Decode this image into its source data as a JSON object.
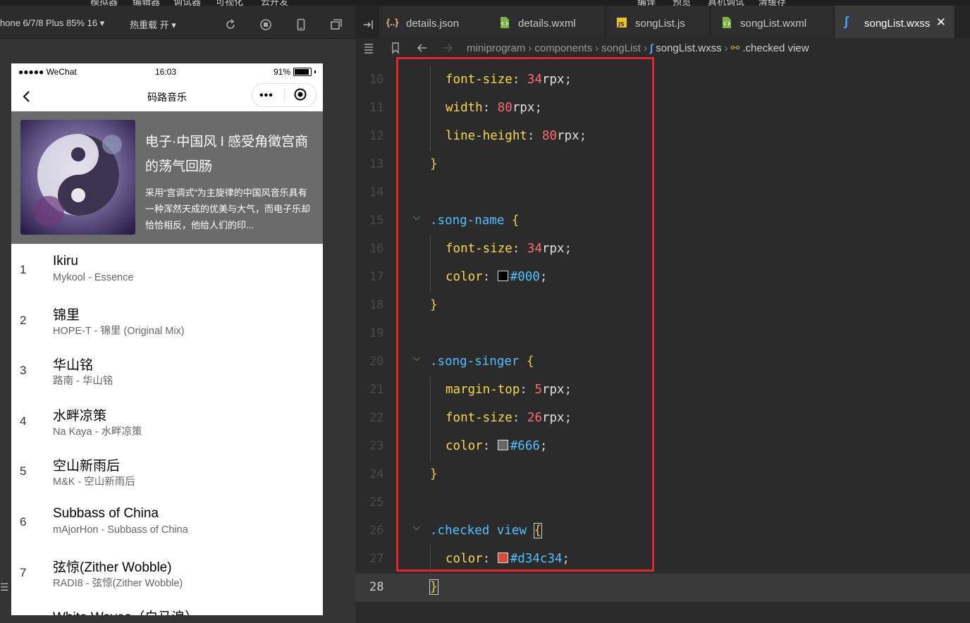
{
  "menu_strip": {
    "left_items": [
      "模拟器",
      "编辑器",
      "调试器",
      "可视化",
      "云开发"
    ],
    "right_items": [
      "编译",
      "预览",
      "真机调试",
      "清缓存"
    ]
  },
  "simulator_toolbar": {
    "device": "hone 6/7/8 Plus 85% 16 ▾",
    "hot_reload": "热重载 开 ▾",
    "icons": [
      "refresh-icon",
      "stop-icon",
      "phone-icon",
      "window-icon"
    ]
  },
  "phone": {
    "status": {
      "carrier": "●●●●● WeChat",
      "time": "16:03",
      "battery": "91%",
      "battery_level": 0.91
    },
    "nav": {
      "title": "码路音乐",
      "menu_dots": "•••"
    },
    "album": {
      "title": "电子·中国风 I 感受角徵宫商的荡气回肠",
      "description": "采用“宫调式”为主旋律的中国风音乐具有一种浑然天成的优美与大气，而电子乐却恰恰相反，他给人们的印..."
    },
    "songs": [
      {
        "index": "1",
        "name": "Ikiru",
        "singer": "Mykool - Essence"
      },
      {
        "index": "2",
        "name": "锦里",
        "singer": "HOPE-T - 锦里 (Original Mix)"
      },
      {
        "index": "3",
        "name": "华山铭",
        "singer": "路南 - 华山铭"
      },
      {
        "index": "4",
        "name": "水畔凉策",
        "singer": "Na Kaya - 水畔凉策"
      },
      {
        "index": "5",
        "name": "空山新雨后",
        "singer": "M&K - 空山新雨后"
      },
      {
        "index": "6",
        "name": "Subbass of China",
        "singer": "mAjorHon - Subbass of China"
      },
      {
        "index": "7",
        "name": "弦惊(Zither Wobble)",
        "singer": "RADI8 - 弦惊(Zither Wobble)"
      },
      {
        "index": "8",
        "name": "White Waves（白马浪）",
        "singer": ""
      }
    ]
  },
  "editor": {
    "tabs": [
      {
        "label": "details.json",
        "icon": "json-icon",
        "active": false
      },
      {
        "label": "details.wxml",
        "icon": "wxml-icon",
        "active": false
      },
      {
        "label": "songList.js",
        "icon": "js-icon",
        "active": false
      },
      {
        "label": "songList.wxml",
        "icon": "wxml-icon",
        "active": false
      },
      {
        "label": "songList.wxss",
        "icon": "css-icon",
        "active": true
      }
    ],
    "close_glyph": "✕",
    "breadcrumb": [
      "miniprogram",
      "components",
      "songList",
      "songList.wxss",
      ".checked view"
    ],
    "colors": {
      "black": "#000",
      "gray": "#666",
      "red": "#d34c34"
    },
    "lines": [
      {
        "n": "10",
        "text": "font-size: 34rpx;"
      },
      {
        "n": "11",
        "text": "width: 80rpx;"
      },
      {
        "n": "12",
        "text": "line-height: 80rpx;"
      },
      {
        "n": "13",
        "text": "}"
      },
      {
        "n": "14",
        "text": ""
      },
      {
        "n": "15",
        "text": ".song-name {"
      },
      {
        "n": "16",
        "text": "font-size: 34rpx;"
      },
      {
        "n": "17",
        "text": "color: #000;"
      },
      {
        "n": "18",
        "text": "}"
      },
      {
        "n": "19",
        "text": ""
      },
      {
        "n": "20",
        "text": ".song-singer {"
      },
      {
        "n": "21",
        "text": "margin-top: 5rpx;"
      },
      {
        "n": "22",
        "text": "font-size: 26rpx;"
      },
      {
        "n": "23",
        "text": "color: #666;"
      },
      {
        "n": "24",
        "text": "}"
      },
      {
        "n": "25",
        "text": ""
      },
      {
        "n": "26",
        "text": ".checked view {"
      },
      {
        "n": "27",
        "text": "color: #d34c34;"
      },
      {
        "n": "28",
        "text": "}"
      }
    ],
    "current_line": "28"
  },
  "left_edge_glyph": "☰"
}
